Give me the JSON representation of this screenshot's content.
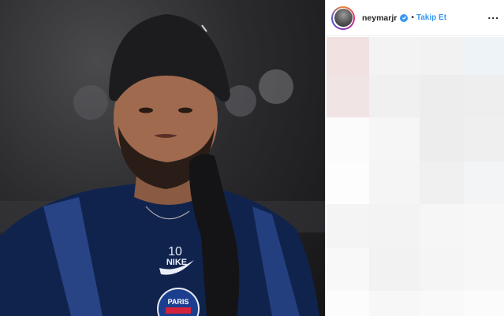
{
  "post": {
    "username": "neymarjr",
    "separator": "•",
    "follow_label": "Takip Et",
    "more_label": "...",
    "verified_icon": "verified-badge-icon",
    "avatar_icon": "profile-avatar-icon"
  },
  "photo": {
    "jersey_number": "10",
    "brand_text": "NIKE",
    "club_text": "PARIS"
  },
  "colors": {
    "accent": "#3897f0",
    "text": "#262626",
    "jersey": "#10234d",
    "hat": "#1c1c1e"
  },
  "blur_cells": [
    "#f1e1e1",
    "#f3f3f4",
    "#f2f2f3",
    "#eef3f8",
    "#f1e4e4",
    "#f0f0f1",
    "#ededee",
    "#eeeeef",
    "#fbfbfb",
    "#f6f6f7",
    "#ededee",
    "#efeff0",
    "#fdfdfd",
    "#f5f5f6",
    "#f0f0f1",
    "#f3f4f6",
    "#f4f4f5",
    "#f3f3f4",
    "#f6f6f7",
    "#f7f7f8",
    "#f8f8f9",
    "#f2f2f3",
    "#f5f5f6",
    "#f7f7f8",
    "#fcfcfc",
    "#f7f7f8",
    "#f9f9fa",
    "#fbfbfb"
  ]
}
